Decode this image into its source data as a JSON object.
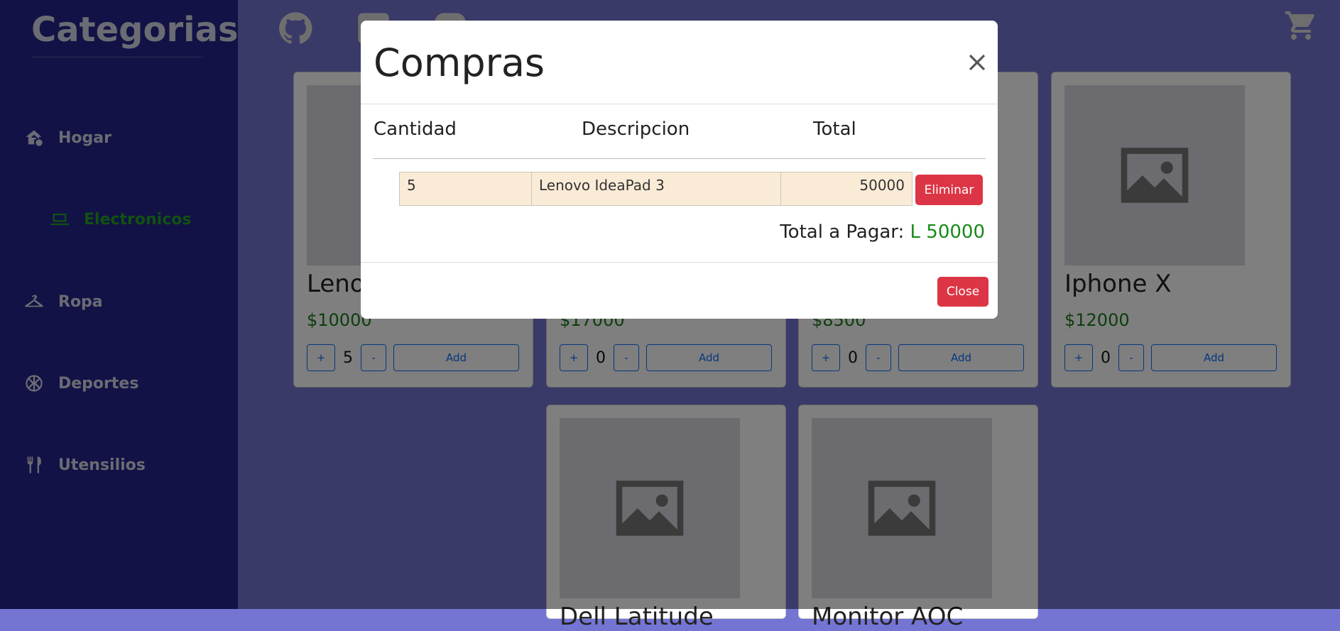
{
  "sidebar": {
    "title": "Categorias",
    "items": [
      {
        "label": "Hogar",
        "icon": "house-icon"
      },
      {
        "label": "Electronicos",
        "icon": "laptop-icon",
        "active": true
      },
      {
        "label": "Ropa",
        "icon": "hanger-icon"
      },
      {
        "label": "Deportes",
        "icon": "ball-icon"
      },
      {
        "label": "Utensilios",
        "icon": "utensils-icon"
      }
    ]
  },
  "header": {
    "icons": [
      "github-icon",
      "facebook-icon",
      "instagram-icon",
      "cart-icon"
    ]
  },
  "products": [
    {
      "name": "Lenovo IdeaPad 3",
      "price": "$10000",
      "qty": "5",
      "add_label": "Add",
      "plus": "+",
      "minus": "-"
    },
    {
      "name": "",
      "price": "$17000",
      "qty": "0",
      "add_label": "Add",
      "plus": "+",
      "minus": "-"
    },
    {
      "name": "",
      "price": "$8500",
      "qty": "0",
      "add_label": "Add",
      "plus": "+",
      "minus": "-"
    },
    {
      "name": "Iphone X",
      "price": "$12000",
      "qty": "0",
      "add_label": "Add",
      "plus": "+",
      "minus": "-"
    },
    {
      "name": "Dell Latitude",
      "price": "",
      "qty": "",
      "add_label": "",
      "plus": "",
      "minus": ""
    },
    {
      "name": "Monitor AOC",
      "price": "",
      "qty": "",
      "add_label": "",
      "plus": "",
      "minus": ""
    }
  ],
  "modal": {
    "title": "Compras",
    "columns": [
      "Cantidad",
      "Descripcion",
      "Total"
    ],
    "rows": [
      {
        "cantidad": "5",
        "descripcion": "Lenovo IdeaPad 3",
        "total": "50000",
        "delete_label": "Eliminar"
      }
    ],
    "total_label": "Total a Pagar:",
    "total_value": "L 50000",
    "close_label": "Close"
  },
  "colors": {
    "sidebar_bg": "#24248c",
    "page_bg": "#7475d3",
    "active_green": "#23a323",
    "danger": "#dc3545",
    "row_bg": "#faebd7"
  }
}
